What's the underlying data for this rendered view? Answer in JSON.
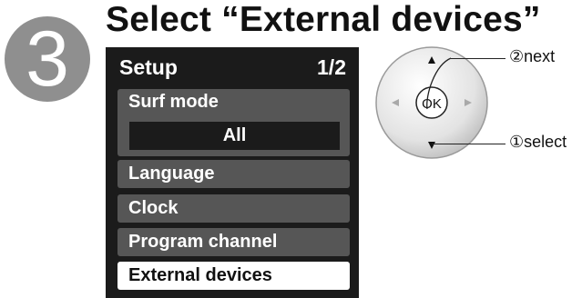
{
  "step": {
    "number": "3",
    "title": "Select “External devices”"
  },
  "menu": {
    "title": "Setup",
    "page": "1/2",
    "surf_mode": {
      "label": "Surf mode",
      "value": "All"
    },
    "items": [
      {
        "label": "Language"
      },
      {
        "label": "Clock"
      },
      {
        "label": "Program channel"
      },
      {
        "label": "External devices",
        "selected": true
      }
    ]
  },
  "remote": {
    "ok_label": "OK",
    "next_label": "②next",
    "select_label": "①select"
  }
}
